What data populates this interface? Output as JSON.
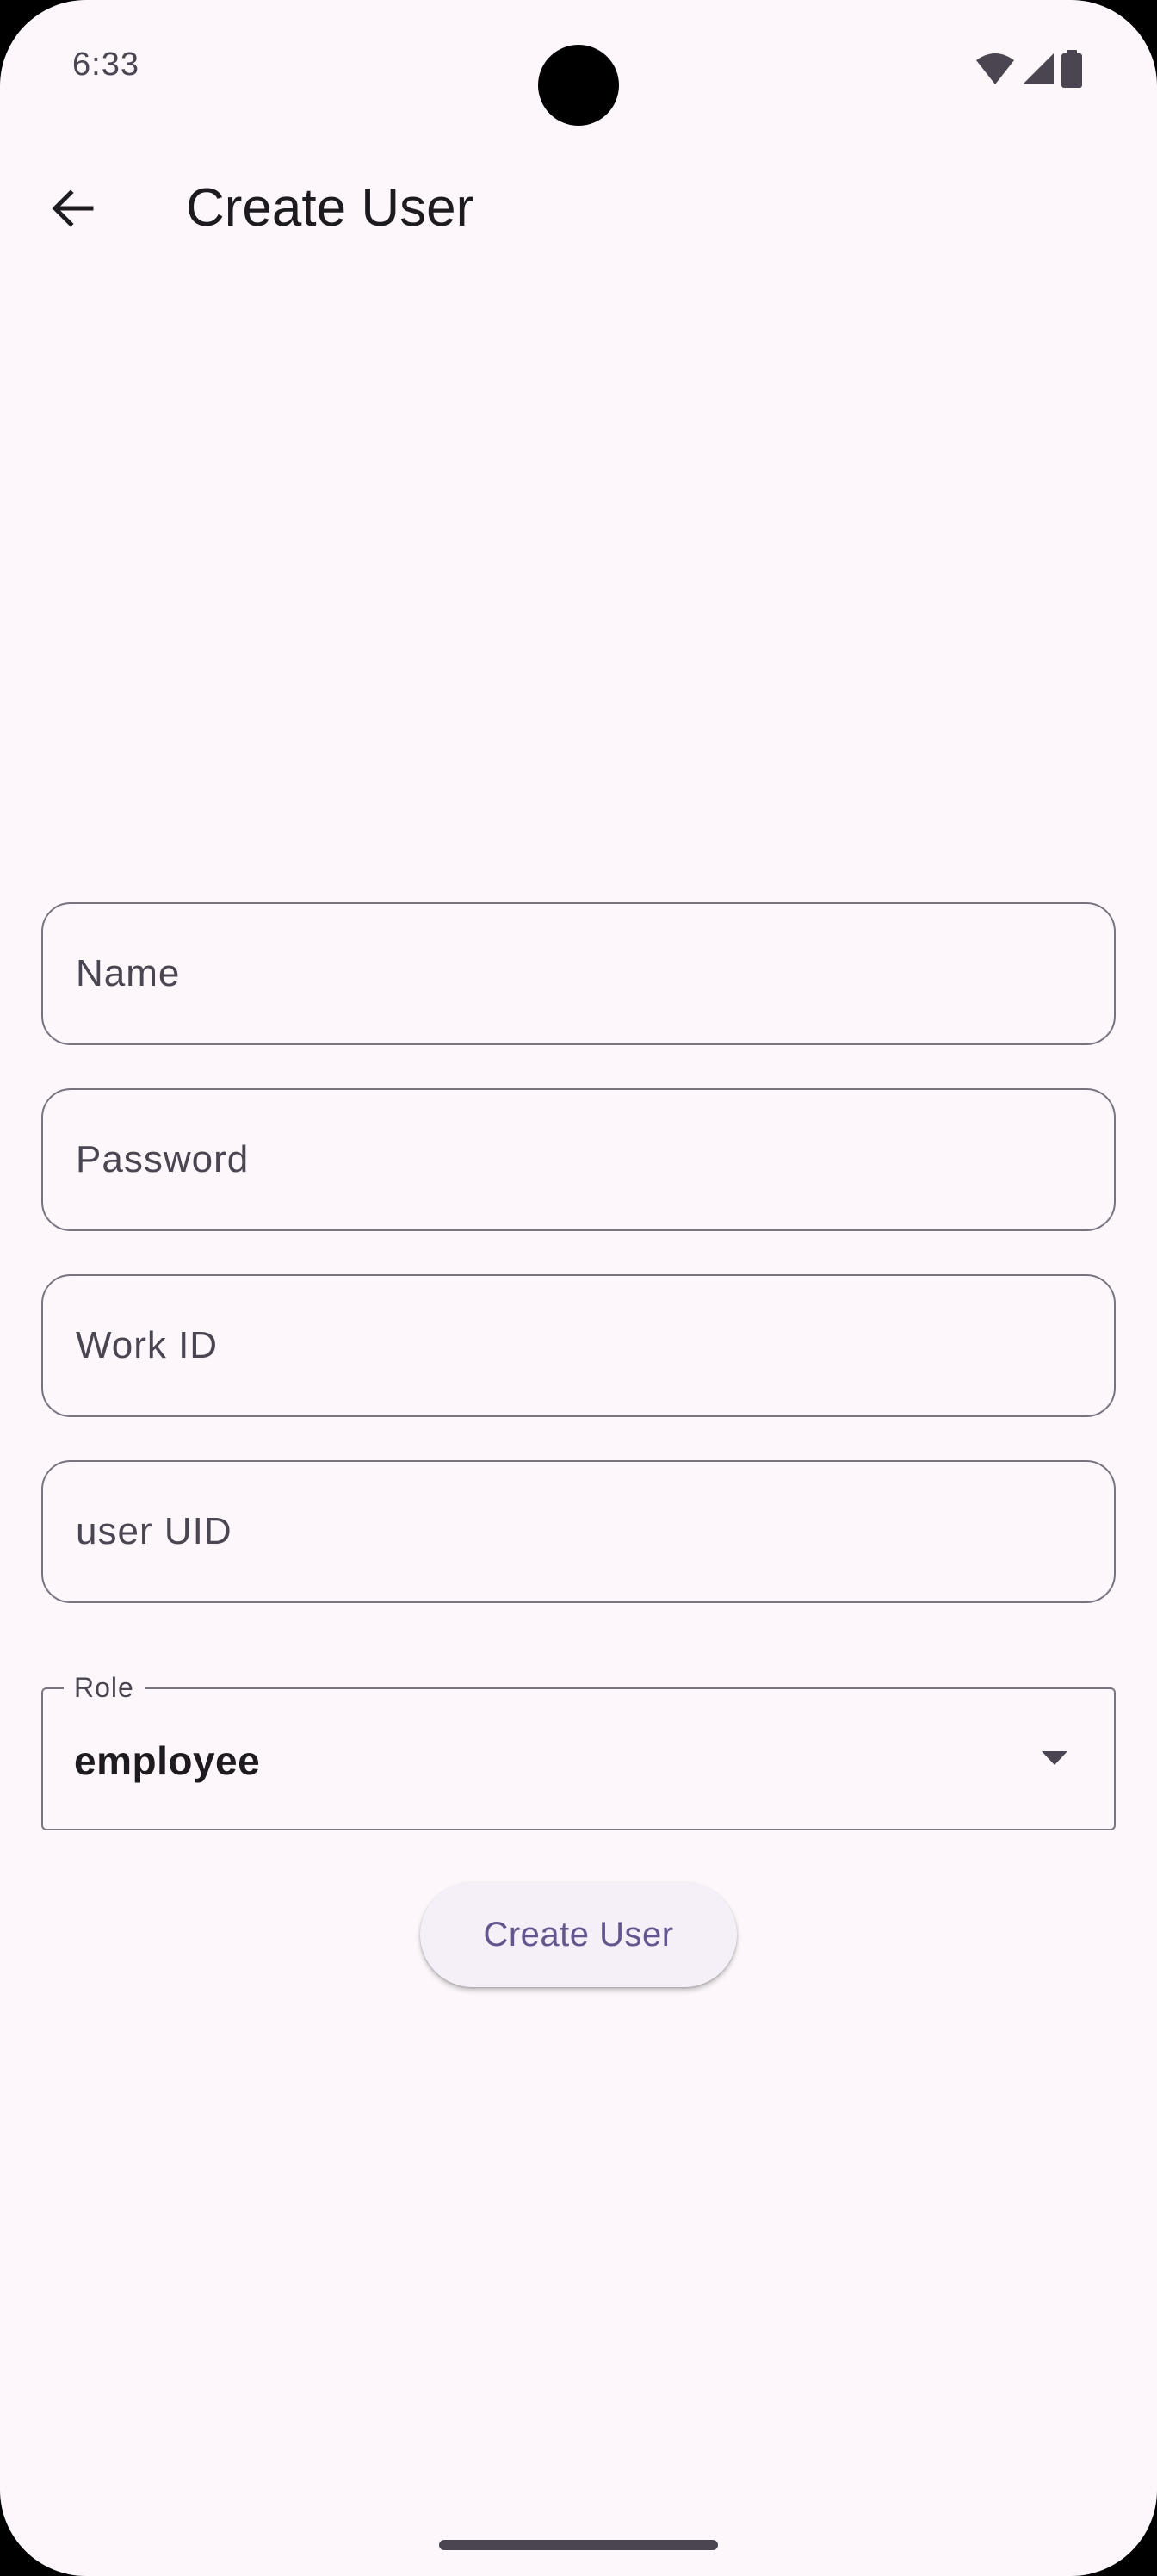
{
  "status_bar": {
    "time": "6:33",
    "icons": [
      "wifi-icon",
      "cellular-signal-icon",
      "battery-icon"
    ]
  },
  "app_bar": {
    "back_icon": "arrow-back-icon",
    "title": "Create User"
  },
  "form": {
    "name_placeholder": "Name",
    "password_placeholder": "Password",
    "work_id_placeholder": "Work ID",
    "user_uid_placeholder": "user UID",
    "role": {
      "label": "Role",
      "selected": "employee",
      "arrow_icon": "arrow-drop-down-icon"
    },
    "submit_label": "Create User"
  },
  "colors": {
    "background": "#fdf7fc",
    "outline": "#79747e",
    "primary": "#65558f",
    "button_surface": "#f5eff7"
  }
}
